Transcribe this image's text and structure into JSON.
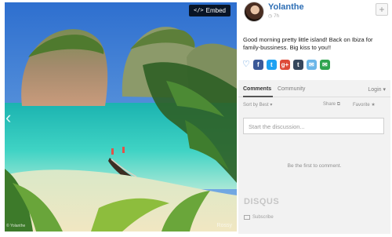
{
  "photo": {
    "embed_label": "Embed",
    "embed_code_glyph": "</>",
    "prev_glyph": "‹",
    "credit": "© Yolanthe",
    "watermark": "Rossy"
  },
  "post": {
    "user_name": "Yolanthe",
    "age": "7h",
    "plus_glyph": "+",
    "caption": "Good morning pretty little island! Back on Ibiza for family-bussiness. Big kiss to you!!",
    "share": [
      {
        "name": "facebook",
        "glyph": "f",
        "color": "#3b5998"
      },
      {
        "name": "twitter",
        "glyph": "t",
        "color": "#1da1f2"
      },
      {
        "name": "google-plus",
        "glyph": "g+",
        "color": "#dd4b39"
      },
      {
        "name": "tumblr",
        "glyph": "t",
        "color": "#35465c"
      },
      {
        "name": "message",
        "glyph": "✉",
        "color": "#6ab6e8"
      },
      {
        "name": "email",
        "glyph": "✉",
        "color": "#2ea44f"
      }
    ]
  },
  "comments": {
    "tab_comments": "Comments",
    "tab_community": "Community",
    "login": "Login",
    "login_caret": "▾",
    "sort_by": "Sort by Best",
    "sort_caret": "▾",
    "share": "Share",
    "favorite": "Favorite",
    "placeholder": "Start the discussion...",
    "empty_text": "Be the first to comment.",
    "brand": "DISQUS",
    "subscribe": "Subscribe"
  }
}
